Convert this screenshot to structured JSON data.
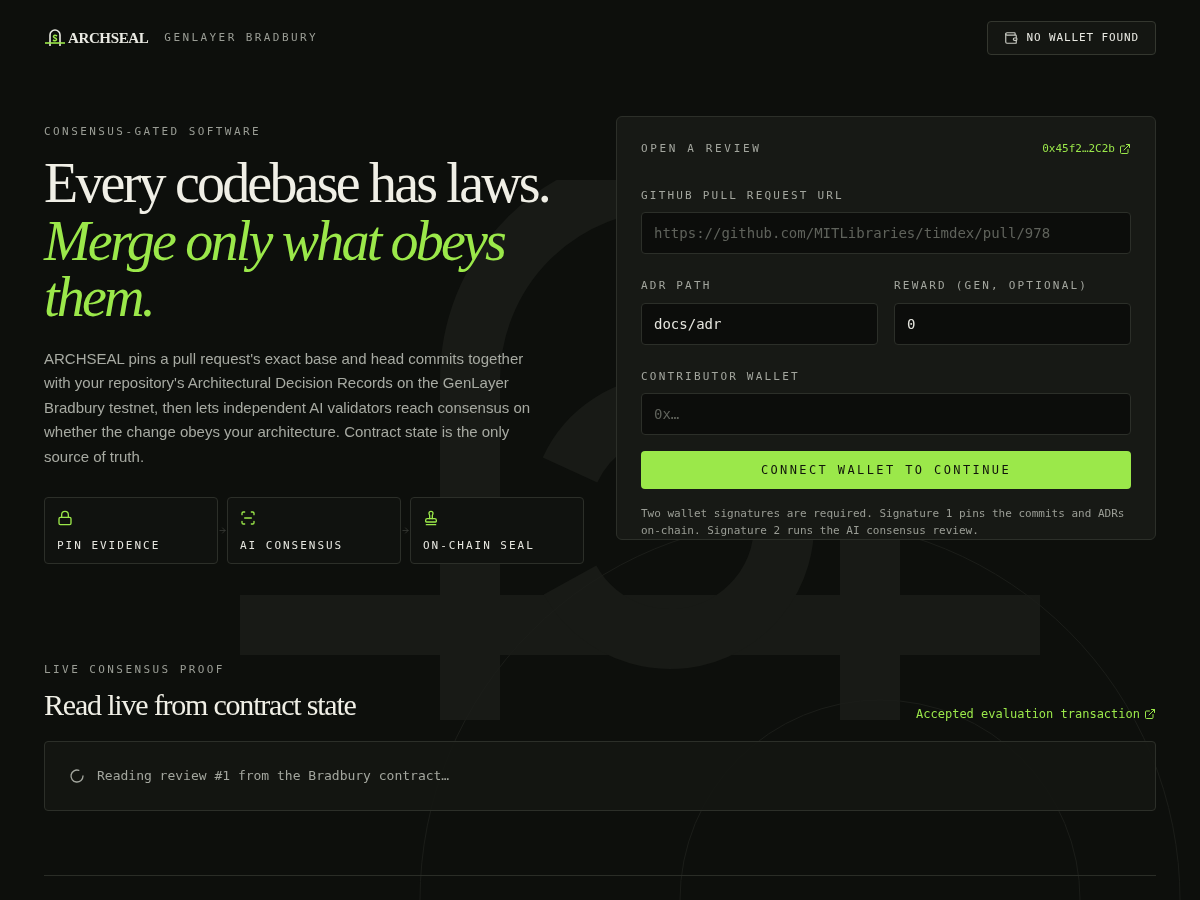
{
  "header": {
    "logo": "ARCHSEAL",
    "network": "GENLAYER BRADBURY",
    "wallet_button": "NO WALLET FOUND"
  },
  "hero": {
    "eyebrow": "CONSENSUS-GATED SOFTWARE",
    "headline": "Every codebase has laws.",
    "headline_accent": "Merge only what obeys them.",
    "description": "ARCHSEAL pins a pull request's exact base and head commits together with your repository's Architectural Decision Records on the GenLayer Bradbury testnet, then lets independent AI validators reach consensus on whether the change obeys your architecture. Contract state is the only source of truth.",
    "steps": [
      {
        "kind": "lock",
        "label": "PIN EVIDENCE"
      },
      {
        "kind": "scan",
        "label": "AI CONSENSUS"
      },
      {
        "kind": "stamp",
        "label": "ON-CHAIN SEAL"
      }
    ]
  },
  "review_form": {
    "title": "OPEN A REVIEW",
    "contract_link": "0x45f2…2C2b",
    "fields": [
      {
        "label": "GITHUB PULL REQUEST URL",
        "placeholder": "https://github.com/MITLibraries/timdex/pull/978"
      },
      {
        "label": "ADR PATH",
        "value": "docs/adr"
      },
      {
        "label": "REWARD (GEN, OPTIONAL)",
        "value": "0"
      },
      {
        "label": "CONTRIBUTOR WALLET",
        "placeholder": "0x…"
      }
    ],
    "submit_button": "CONNECT WALLET TO CONTINUE",
    "note": "Two wallet signatures are required. Signature 1 pins the commits and ADRs on-chain. Signature 2 runs the AI consensus review."
  },
  "proof": {
    "eyebrow": "LIVE CONSENSUS PROOF",
    "title": "Read live from contract state",
    "transaction_link": "Accepted evaluation transaction",
    "status": "Reading review #1 from the Bradbury contract…"
  }
}
